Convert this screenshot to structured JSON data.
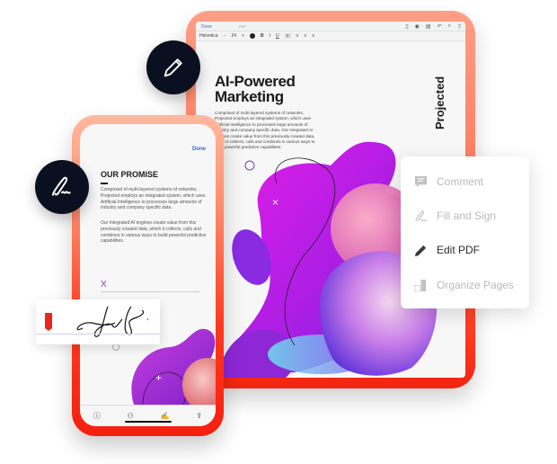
{
  "tablet": {
    "topbar": {
      "done_label": "Done",
      "doc_label": "PDF"
    },
    "format_bar": {
      "font": "Helvetica",
      "size": "24",
      "minus": "−",
      "plus": "+",
      "bold": "B",
      "italic": "I",
      "underline": "U"
    },
    "headline_line1": "AI-Powered",
    "headline_line2": "Marketing",
    "body": "Comprised of multi-layered systems of networks, Projected employs an integrated system, which uses Artificial Intelligence to processes large amounts of industry and company specific data. Our Integrated AI engines create value from this previously created data, which it collects, culls and combines in various ways to build powerful predictive capabilities.",
    "side_title": "Projected"
  },
  "phone": {
    "done_label": "Done",
    "title": "OUR PROMISE",
    "paragraph1": "Comprised of multi-layered systems of networks, Projected employs an integrated system, which uses Artificial Intelligence to processes large amounts of industry and company specific data.",
    "paragraph2": "Our Integrated AI engines create value from this previously created data, which it collects, culls and combines in various ways to build powerful predictive capabilities.",
    "sign_marker": "X",
    "tabbar": [
      {
        "icon": "info-icon"
      },
      {
        "icon": "person-icon"
      },
      {
        "icon": "fill-sign-icon"
      },
      {
        "icon": "share-icon"
      }
    ]
  },
  "badges": {
    "edit": "pencil-icon",
    "sign": "signature-icon"
  },
  "menu": {
    "items": [
      {
        "label": "Comment",
        "icon": "comment-icon",
        "active": false
      },
      {
        "label": "Fill and Sign",
        "icon": "fill-sign-icon",
        "active": false
      },
      {
        "label": "Edit PDF",
        "icon": "pencil-icon",
        "active": true
      },
      {
        "label": "Organize Pages",
        "icon": "organize-pages-icon",
        "active": false
      }
    ]
  },
  "colors": {
    "accent_red": "#f22410",
    "accent_coral": "#ff8a6a",
    "purple": "#c51ee8",
    "badge": "#0b1020"
  }
}
